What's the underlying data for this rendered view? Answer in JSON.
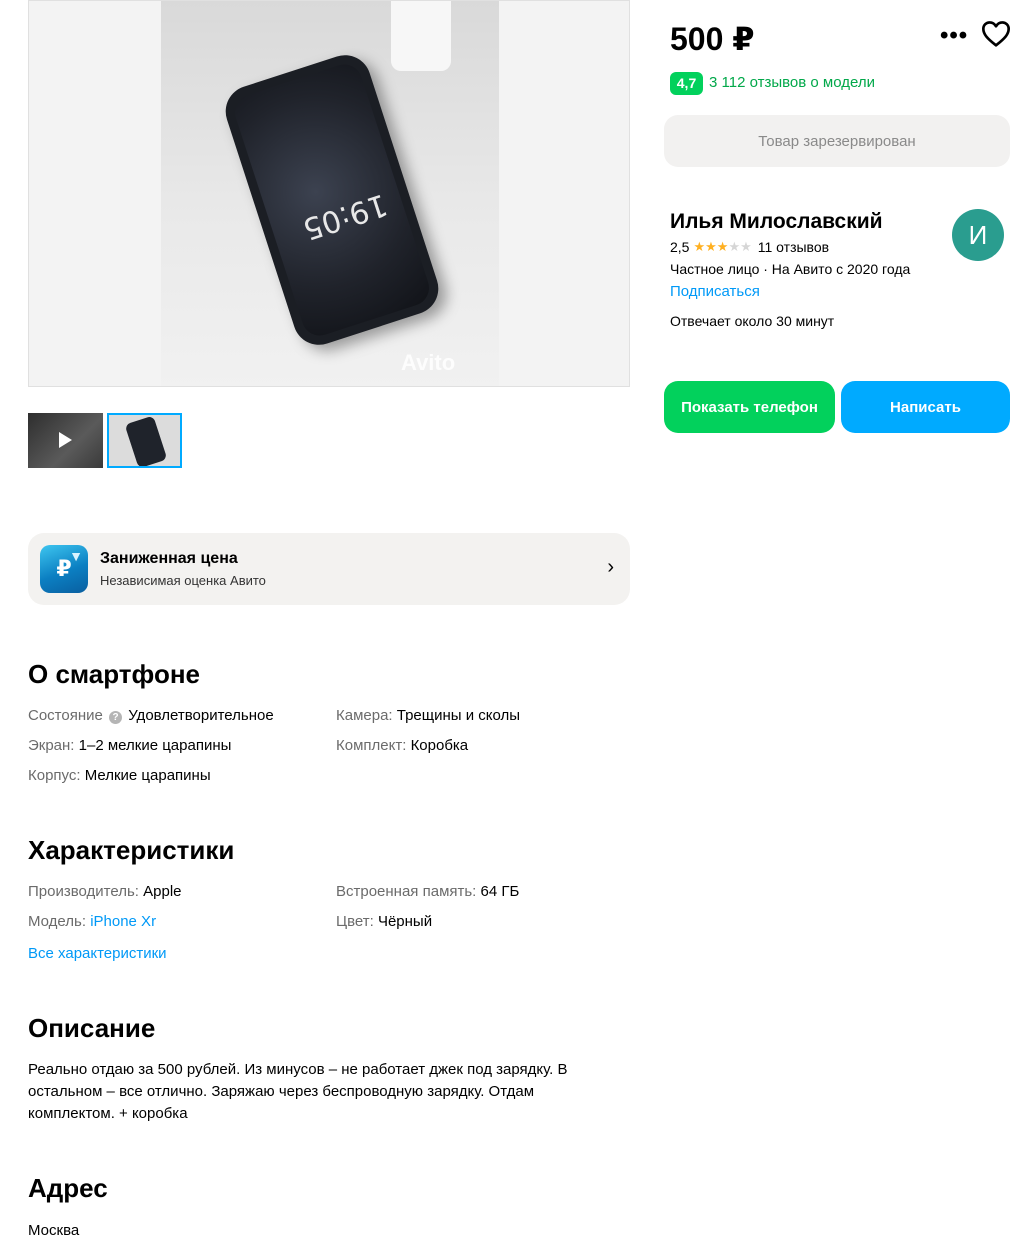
{
  "gallery": {
    "watermark": "Avito",
    "clock_text": "19:05"
  },
  "promo": {
    "icon_text": "₽",
    "title": "Заниженная цена",
    "subtitle": "Независимая оценка Авито",
    "chevron": "›"
  },
  "about": {
    "title": "О смартфоне",
    "condition_key": "Состояние",
    "condition_value": "Удовлетворительное",
    "screen_key": "Экран:",
    "screen_value": "1–2 мелкие царапины",
    "body_key": "Корпус:",
    "body_value": "Мелкие царапины",
    "camera_key": "Камера:",
    "camera_value": "Трещины и сколы",
    "kit_key": "Комплект:",
    "kit_value": "Коробка"
  },
  "specs": {
    "title": "Характеристики",
    "maker_key": "Производитель:",
    "maker_value": "Apple",
    "model_key": "Модель:",
    "model_value": "iPhone Xr",
    "memory_key": "Встроенная память:",
    "memory_value": "64 ГБ",
    "color_key": "Цвет:",
    "color_value": "Чёрный",
    "all_link": "Все характеристики"
  },
  "description": {
    "title": "Описание",
    "text": "Реально отдаю за 500 рублей. Из минусов – не работает джек под зарядку. В остальном – все отлично. Заряжаю через беспроводную зарядку. Отдам комплектом. + коробка"
  },
  "address": {
    "title": "Адрес",
    "city": "Москва"
  },
  "offer": {
    "price": "500 ₽",
    "more": "•••",
    "model_rating": "4,7",
    "model_reviews": "3 112 отзывов о модели",
    "reserved": "Товар зарезервирован"
  },
  "seller": {
    "name": "Илья Милославский",
    "rating": "2,5",
    "rating_value": 2.5,
    "reviews": "11 отзывов",
    "info": "Частное лицо · На Авито с 2020 года",
    "subscribe": "Подписаться",
    "answer_time": "Отвечает около 30 минут",
    "avatar_letter": "И"
  },
  "buttons": {
    "show_phone": "Показать телефон",
    "write": "Написать"
  },
  "colors": {
    "green": "#02d15c",
    "blue": "#00aaff",
    "link": "#0099f7"
  }
}
